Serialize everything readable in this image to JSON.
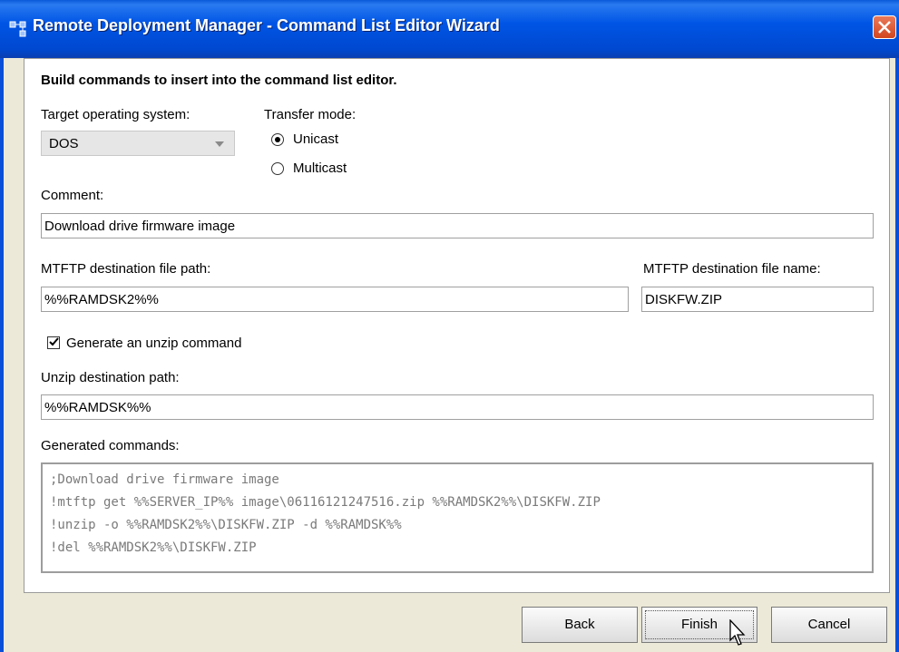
{
  "window": {
    "title": "Remote Deployment Manager - Command List Editor Wizard",
    "icon": "app-icon",
    "close_icon": "close-icon"
  },
  "instruction": "Build commands to insert into the command list editor.",
  "target_os": {
    "label": "Target operating system:",
    "value": "DOS"
  },
  "transfer_mode": {
    "label": "Transfer mode:",
    "options": [
      {
        "label": "Unicast",
        "selected": true
      },
      {
        "label": "Multicast",
        "selected": false
      }
    ]
  },
  "comment": {
    "label": "Comment:",
    "value": "Download drive firmware image"
  },
  "mtftp_path": {
    "label": "MTFTP destination file path:",
    "value": "%%RAMDSK2%%"
  },
  "mtftp_name": {
    "label": "MTFTP destination file name:",
    "value": "DISKFW.ZIP"
  },
  "unzip_checkbox": {
    "label": "Generate an unzip command",
    "checked": true
  },
  "unzip_path": {
    "label": "Unzip destination path:",
    "value": "%%RAMDSK%%"
  },
  "generated": {
    "label": "Generated commands:",
    "lines": [
      ";Download drive firmware image",
      "!mtftp get %%SERVER_IP%% image\\06116121247516.zip %%RAMDSK2%%\\DISKFW.ZIP",
      "!unzip -o %%RAMDSK2%%\\DISKFW.ZIP -d %%RAMDSK%%",
      "!del %%RAMDSK2%%\\DISKFW.ZIP"
    ]
  },
  "buttons": {
    "back": "Back",
    "finish": "Finish",
    "cancel": "Cancel"
  },
  "colors": {
    "titlebar": "#0055E5",
    "dialog_bg": "#ECE9D8",
    "panel_bg": "#FFFFFF",
    "generated_text": "#7A7A7A"
  }
}
